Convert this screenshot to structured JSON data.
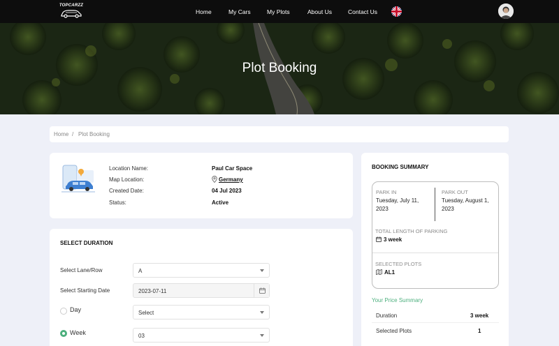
{
  "brand": {
    "logo_text": "TOPCARZZ"
  },
  "nav": {
    "items": [
      "Home",
      "My Cars",
      "My Plots",
      "About Us",
      "Contact Us"
    ]
  },
  "hero": {
    "title": "Plot Booking"
  },
  "breadcrumb": {
    "home": "Home",
    "separator": "/",
    "current": "Plot Booking"
  },
  "location": {
    "name_label": "Location Name:",
    "name_value": "Paul Car Space",
    "map_label": "Map Location:",
    "map_value": "Germany",
    "created_label": "Created Date:",
    "created_value": "04 Jul 2023",
    "status_label": "Status:",
    "status_value": "Active"
  },
  "duration": {
    "title": "SELECT DURATION",
    "lane_label": "Select Lane/Row",
    "lane_value": "A",
    "start_label": "Select Starting Date",
    "start_value": "2023-07-11",
    "day_label": "Day",
    "day_value": "Select",
    "week_label": "Week",
    "week_value": "03",
    "selected_option": "Week"
  },
  "summary": {
    "title": "BOOKING SUMMARY",
    "park_in_label": "PARK IN",
    "park_in_value": "Tuesday, July 11, 2023",
    "park_out_label": "PARK OUT",
    "park_out_value": "Tuesday, August 1, 2023",
    "length_label": "TOTAL LENGTH OF PARKING",
    "length_value": "3 week",
    "plots_label": "SELECTED PLOTS",
    "plots_value": "AL1",
    "price_title": "Your Price Summary",
    "rows": [
      {
        "label": "Duration",
        "value": "3 week"
      },
      {
        "label": "Selected Plots",
        "value": "1"
      }
    ]
  },
  "colors": {
    "accent": "#4caf7d",
    "nav_bg": "#0d0d0d",
    "page_bg": "#eef0f8"
  }
}
